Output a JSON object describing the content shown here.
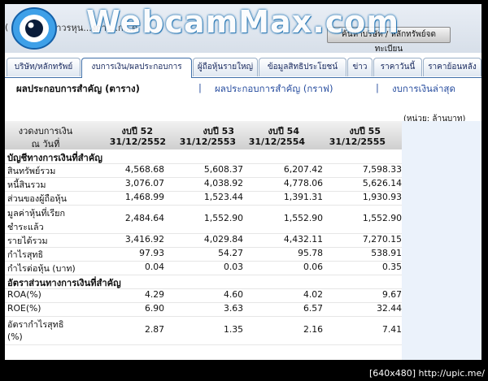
{
  "header": {
    "company_fragment": "มาวรหุน...งกา....ก...ด",
    "company_fragment2": "(",
    "search_label": "ค้นหาบริษัท / หลักทรัพย์จดทะเบียน",
    "watermark_logo": "WebcamMax.com"
  },
  "tabs": [
    {
      "label": "บริษัท/หลักทรัพย์"
    },
    {
      "label": "งบการเงิน/ผลประกอบการ"
    },
    {
      "label": "ผู้ถือหุ้นรายใหญ่"
    },
    {
      "label": "ข้อมูลสิทธิประโยชน์"
    },
    {
      "label": "ข่าว"
    },
    {
      "label": "ราคาวันนี้"
    },
    {
      "label": "ราคาย้อนหลัง"
    }
  ],
  "subnav": {
    "active": "ผลประกอบการสำคัญ (ตาราง)",
    "link1": "ผลประกอบการสำคัญ (กราฟ)",
    "link2": "งบการเงินล่าสุด",
    "separator": "|"
  },
  "unit_note": "(หน่วย: ล้านบาท)",
  "table": {
    "col0_line1": "งวดงบการเงิน",
    "col0_line2": "ณ วันที่",
    "columns": [
      {
        "year": "งบปี 52",
        "date": "31/12/2552"
      },
      {
        "year": "งบปี 53",
        "date": "31/12/2553"
      },
      {
        "year": "งบปี 54",
        "date": "31/12/2554"
      },
      {
        "year": "งบปี 55",
        "date": "31/12/2555"
      }
    ],
    "sections": [
      {
        "title": "บัญชีทางการเงินที่สำคัญ",
        "rows": [
          {
            "label": "สินทรัพย์รวม",
            "values": [
              "4,568.68",
              "5,608.37",
              "6,207.42",
              "7,598.33"
            ]
          },
          {
            "label": "หนี้สินรวม",
            "values": [
              "3,076.07",
              "4,038.92",
              "4,778.06",
              "5,626.14"
            ]
          },
          {
            "label": "ส่วนของผู้ถือหุ้น",
            "values": [
              "1,468.99",
              "1,523.44",
              "1,391.31",
              "1,930.93"
            ]
          },
          {
            "label": "มูลค่าหุ้นที่เรียก",
            "label2": "ชำระแล้ว",
            "values": [
              "2,484.64",
              "1,552.90",
              "1,552.90",
              "1,552.90"
            ]
          },
          {
            "label": "รายได้รวม",
            "values": [
              "3,416.92",
              "4,029.84",
              "4,432.11",
              "7,270.15"
            ]
          },
          {
            "label": "กำไรสุทธิ",
            "values": [
              "97.93",
              "54.27",
              "95.78",
              "538.91"
            ]
          },
          {
            "label": "กำไรต่อหุ้น (บาท)",
            "values": [
              "0.04",
              "0.03",
              "0.06",
              "0.35"
            ]
          }
        ]
      },
      {
        "title": "อัตราส่วนทางการเงินที่สำคัญ",
        "rows": [
          {
            "label": "ROA(%)",
            "values": [
              "4.29",
              "4.60",
              "4.02",
              "9.67"
            ]
          },
          {
            "label": "ROE(%)",
            "values": [
              "6.90",
              "3.63",
              "6.57",
              "32.44"
            ]
          },
          {
            "label": "อัตรากำไรสุทธิ",
            "label2": "(%)",
            "values": [
              "2.87",
              "1.35",
              "2.16",
              "7.41"
            ]
          }
        ]
      }
    ]
  },
  "watermark": "[640x480] http://upic.me/"
}
